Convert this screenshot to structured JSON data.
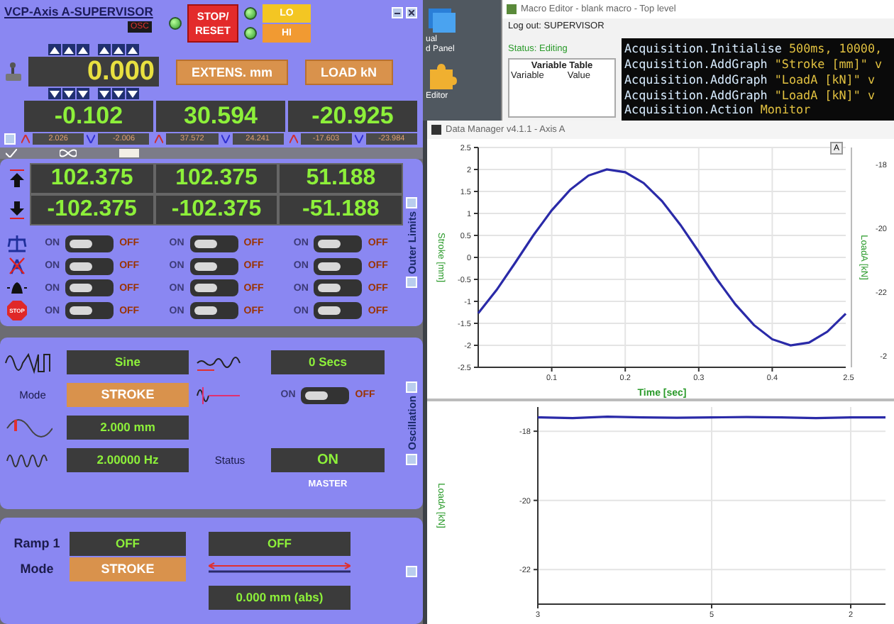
{
  "supervisor": {
    "title": "VCP-Axis A-SUPERVISOR",
    "osc_label": "OSC",
    "stop_button": "STOP/ RESET",
    "limit_buttons": [
      {
        "label": "LO",
        "kind": "lo"
      },
      {
        "label": "HI",
        "kind": "hi"
      }
    ],
    "setpoint": "0.000",
    "channel_buttons": [
      "EXTENS. mm",
      "LOAD kN"
    ],
    "readouts": [
      {
        "value": "-0.102",
        "peak_high": "2.026",
        "peak_low": "-2.006"
      },
      {
        "value": "30.594",
        "peak_high": "37.572",
        "peak_low": "24.241"
      },
      {
        "value": "-20.925",
        "peak_high": "-17.603",
        "peak_low": "-23.984"
      }
    ]
  },
  "limits": {
    "side_label": "Outer Limits",
    "rows": [
      {
        "kind": "upper",
        "values": [
          "102.375",
          "102.375",
          "51.188"
        ]
      },
      {
        "kind": "lower",
        "values": [
          "-102.375",
          "-102.375",
          "-51.188"
        ]
      }
    ],
    "switch_rows": [
      {
        "kind": "weights",
        "switches": [
          {
            "on_label": "ON",
            "off_label": "OFF",
            "on": false
          },
          {
            "on_label": "ON",
            "off_label": "OFF",
            "on": false
          },
          {
            "on_label": "ON",
            "off_label": "OFF",
            "on": false
          }
        ]
      },
      {
        "kind": "crossed",
        "switches": [
          {
            "on_label": "ON",
            "off_label": "OFF",
            "on": false
          },
          {
            "on_label": "ON",
            "off_label": "OFF",
            "on": false
          },
          {
            "on_label": "ON",
            "off_label": "OFF",
            "on": false
          }
        ]
      },
      {
        "kind": "alarm",
        "switches": [
          {
            "on_label": "ON",
            "off_label": "OFF",
            "on": false
          },
          {
            "on_label": "ON",
            "off_label": "OFF",
            "on": false
          },
          {
            "on_label": "ON",
            "off_label": "OFF",
            "on": false
          }
        ]
      },
      {
        "kind": "stop",
        "icon_label": "STOP",
        "switches": [
          {
            "on_label": "ON",
            "off_label": "OFF",
            "on": false
          },
          {
            "on_label": "ON",
            "off_label": "OFF",
            "on": false
          },
          {
            "on_label": "ON",
            "off_label": "OFF",
            "on": false
          }
        ]
      }
    ]
  },
  "oscillation": {
    "side_label": "Oscillation",
    "waveform": "Sine",
    "mode_label": "Mode",
    "mode": "STROKE",
    "amplitude": "2.000 mm",
    "frequency": "2.00000 Hz",
    "delay": "0 Secs",
    "hold_switch": {
      "on_label": "ON",
      "off_label": "OFF",
      "on": false
    },
    "status_label": "Status",
    "status": "ON",
    "status_caption": "MASTER"
  },
  "ramp": {
    "label": "Ramp 1",
    "state": "OFF",
    "mode_label": "Mode",
    "mode": "STROKE",
    "target": "OFF",
    "position": "0.000 mm (abs)"
  },
  "desktop": {
    "icons": [
      {
        "kind": "panel",
        "lines": [
          "ual",
          "d Panel"
        ]
      },
      {
        "kind": "puzzle",
        "lines": [
          "Editor"
        ]
      }
    ]
  },
  "macro_editor": {
    "title": "Macro Editor - blank macro - Top level",
    "logout": "Log out: SUPERVISOR",
    "status": "Status: Editing",
    "variable_table": {
      "title": "Variable Table",
      "columns": [
        "Variable",
        "Value"
      ]
    },
    "code": [
      {
        "command": "Acquisition.Initialise",
        "args": "500ms, 10000,"
      },
      {
        "command": "Acquisition.AddGraph",
        "args": "\"Stroke [mm]\" v"
      },
      {
        "command": "Acquisition.AddGraph",
        "args": "\"LoadA [kN]\" v"
      },
      {
        "command": "Acquisition.AddGraph",
        "args": "\"LoadA [kN]\" v"
      },
      {
        "command": "Acquisition.Action",
        "args": "Monitor"
      }
    ]
  },
  "data_manager": {
    "title": "Data Manager v4.1.1 - Axis A",
    "corner_button": "A",
    "top_plot": {
      "right_axis": {
        "label": "LoadA [kN]",
        "ticks": [
          "-18",
          "-20",
          "-22",
          "-2"
        ]
      },
      "x_axis_end_label": "2.5",
      "chart_data": {
        "type": "line",
        "xlabel": "Time [sec]",
        "ylabel": "Stroke [mm]",
        "x": [
          0,
          0.025,
          0.05,
          0.075,
          0.1,
          0.125,
          0.15,
          0.175,
          0.2,
          0.225,
          0.25,
          0.275,
          0.3,
          0.325,
          0.35,
          0.375,
          0.4,
          0.425,
          0.45,
          0.475,
          0.5
        ],
        "series": [
          {
            "color": "#2a2aa8",
            "values": [
              -1.27,
              -0.74,
              -0.13,
              0.5,
              1.07,
              1.54,
              1.86,
              2.0,
              1.94,
              1.69,
              1.28,
              0.74,
              0.13,
              -0.5,
              -1.07,
              -1.54,
              -1.86,
              -2.0,
              -1.94,
              -1.69,
              -1.28
            ]
          }
        ],
        "xlim": [
          0,
          0.5
        ],
        "ylim": [
          -2.5,
          2.5
        ],
        "grid": true,
        "xticks": [
          0.1,
          0.2,
          0.3,
          0.4
        ],
        "yticks": [
          -2.5,
          -2,
          -1.5,
          -1,
          -0.5,
          0,
          0.5,
          1,
          1.5,
          2,
          2.5
        ]
      }
    },
    "bottom_plot": {
      "chart_data": {
        "type": "line",
        "ylabel": "LoadA [kN]",
        "categories": [
          "3",
          null,
          null,
          null,
          null,
          "5",
          null,
          null,
          null,
          "2",
          null
        ],
        "series": [
          {
            "color": "#2a2aa8",
            "values": [
              -17.6,
              -17.62,
              -17.58,
              -17.6,
              -17.61,
              -17.6,
              -17.59,
              -17.6,
              -17.62,
              -17.6,
              -17.6
            ]
          }
        ],
        "ylim": [
          -23,
          -17.3
        ],
        "grid": true,
        "yticks": [
          -18,
          -20,
          -22
        ]
      }
    }
  }
}
